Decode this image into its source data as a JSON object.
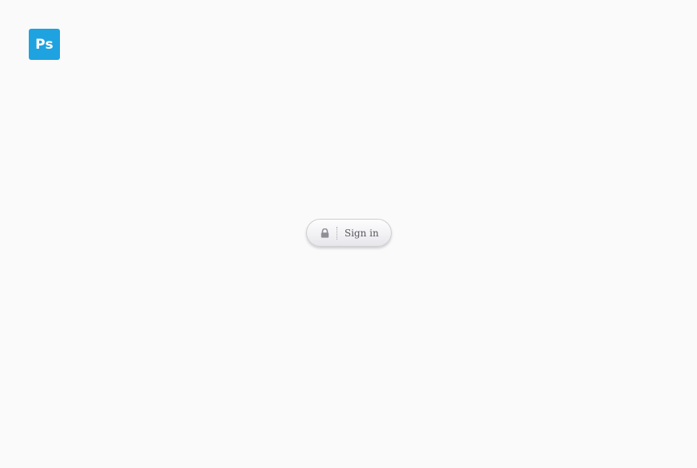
{
  "logo": {
    "text": "Ps",
    "icon": "photoshop-logo-icon",
    "color": "#1fa2e0"
  },
  "signin": {
    "label": "Sign in",
    "icon": "lock-icon"
  }
}
